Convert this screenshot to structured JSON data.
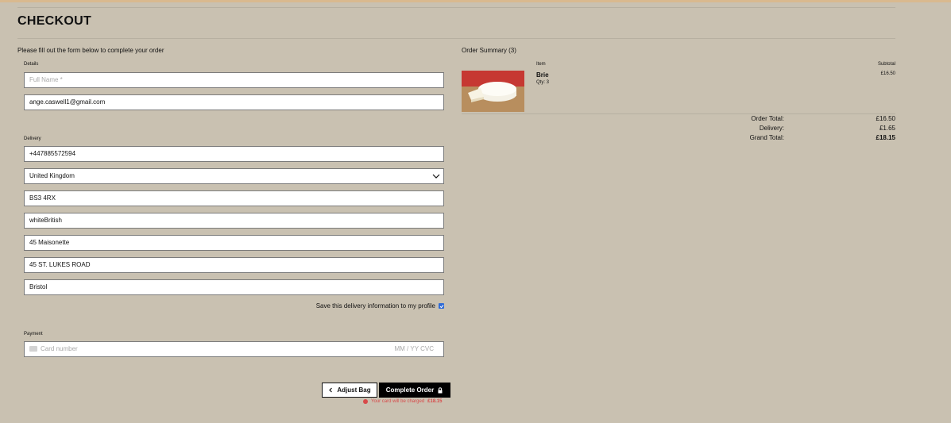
{
  "page": {
    "title": "CHECKOUT",
    "intro": "Please fill out the form below to complete your order"
  },
  "details": {
    "label": "Details",
    "full_name_placeholder": "Full Name *",
    "email_value": "ange.caswell1@gmail.com"
  },
  "delivery": {
    "label": "Delivery",
    "phone": "+447885572594",
    "country": "United Kingdom",
    "postcode": "BS3 4RX",
    "town_or_city": "whiteBritish",
    "street_address1": "45 Maisonette",
    "street_address2": "45 ST. LUKES ROAD",
    "county": "Bristol",
    "save_info_label": "Save this delivery information to my profile",
    "save_info_checked": true
  },
  "payment": {
    "label": "Payment",
    "card_placeholder": "Card number",
    "expiry_cvc_placeholder": "MM / YY  CVC"
  },
  "actions": {
    "adjust_bag_label": "Adjust Bag",
    "complete_order_label": "Complete Order",
    "charge_prefix": "Your card will be charged",
    "charge_amount": "£18.15"
  },
  "summary": {
    "title": "Order Summary (3)",
    "col_item": "Item",
    "col_subtotal": "Subtotal",
    "items": [
      {
        "name": "Brie",
        "qty": "Qty: 3",
        "subtotal": "£16.50",
        "image": "brie-cheese-image"
      }
    ],
    "order_total_label": "Order Total:",
    "order_total": "£16.50",
    "delivery_label": "Delivery:",
    "delivery": "£1.65",
    "grand_total_label": "Grand Total:",
    "grand_total": "£18.15"
  },
  "colors": {
    "background": "#c9c1b1",
    "accent_bar": "#d9b98f",
    "primary_button": "#000000",
    "error_text": "#d84a4a",
    "checkbox": "#2f6bd6"
  }
}
